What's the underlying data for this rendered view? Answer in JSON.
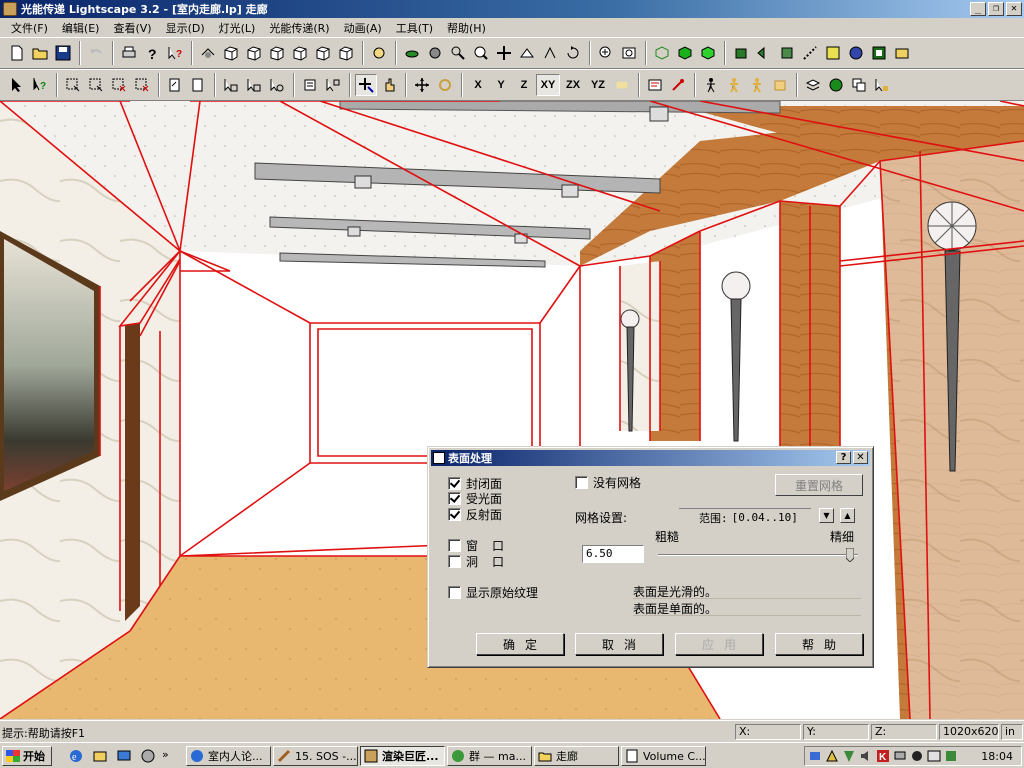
{
  "window": {
    "title": "光能传递 Lightscape 3.2 - [室内走廊.lp] 走廊",
    "min": "_",
    "max": "❐",
    "close": "✕"
  },
  "menu": [
    "文件(F)",
    "编辑(E)",
    "查看(V)",
    "显示(D)",
    "灯光(L)",
    "光能传递(R)",
    "动画(A)",
    "工具(T)",
    "帮助(H)"
  ],
  "toolbar2_text": [
    "X",
    "Y",
    "Z",
    "XY",
    "ZX",
    "YZ"
  ],
  "dialog": {
    "title": "表面处理",
    "help_btn": "?",
    "close_btn": "✕",
    "cb_closed": "封闭面",
    "cb_receive": "受光面",
    "cb_reflect": "反射面",
    "cb_window": "窗",
    "cb_window_mark": "口",
    "cb_hole": "洞",
    "cb_hole_mark": "口",
    "cb_no_mesh": "没有网格",
    "cb_show_texture": "显示原始纹理",
    "reset_mesh": "重置网格",
    "mesh_settings": "网格设置:",
    "range_label": "范围:",
    "range_value": "[0.04..10]",
    "coarse": "粗糙",
    "fine": "精细",
    "mesh_value": "6.50",
    "slider_level": 0.96,
    "info1": "表面是光滑的。",
    "info2": "表面是单面的。",
    "ok": "确定",
    "cancel": "取消",
    "apply": "应用",
    "help": "帮助",
    "checked": {
      "closed": true,
      "receive": true,
      "reflect": true,
      "window": false,
      "hole": false,
      "no_mesh": false,
      "show_texture": false
    }
  },
  "status": {
    "hint": "提示:帮助请按F1",
    "x_label": "X:",
    "y_label": "Y:",
    "z_label": "Z:",
    "resolution": "1020x620",
    "unit": "in"
  },
  "taskbar": {
    "start": "开始",
    "tasks": [
      "室内人论...",
      "15. SOS -...",
      "渲染巨匠...",
      "群 — ma...",
      "走廊",
      "Volume C..."
    ],
    "active_task": 2,
    "clock": "18:04"
  },
  "colors": {
    "wire_red": "#e01010",
    "wood": "#c07838",
    "floor": "#e6b872",
    "ceiling": "#f2f0ec"
  }
}
